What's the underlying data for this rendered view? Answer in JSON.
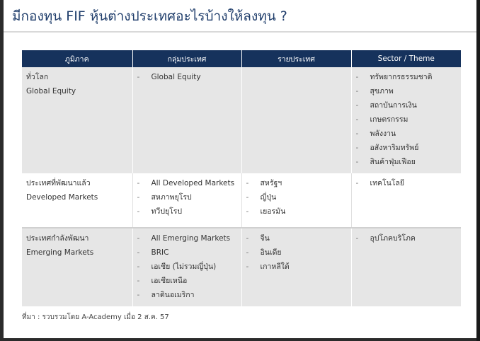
{
  "title": "มีกองทุน FIF หุ้นต่างประเทศอะไรบ้างให้ลงทุน ?",
  "table": {
    "headers": [
      "ภูมิภาค",
      "กลุ่มประเทศ",
      "รายประเทศ",
      "Sector / Theme"
    ],
    "rows": [
      {
        "region": [
          "ทั่วโลก",
          "Global Equity"
        ],
        "groups": [
          "Global Equity"
        ],
        "countries": [],
        "sectors": [
          "ทรัพยากรธรรมชาติ",
          "สุขภาพ",
          "สถาบันการเงิน",
          "เกษตรกรรม",
          "พลังงาน",
          "อสังหาริมทรัพย์",
          "สินค้าฟุ่มเฟือย"
        ]
      },
      {
        "region": [
          "ประเทศที่พัฒนาแล้ว",
          "Developed Markets"
        ],
        "groups": [
          "All Developed Markets",
          "สหภาพยุโรป",
          "ทวีปยุโรป"
        ],
        "countries": [
          "สหรัฐฯ",
          "ญี่ปุ่น",
          "เยอรมัน"
        ],
        "sectors": [
          "เทคโนโลยี"
        ]
      },
      {
        "region": [
          "ประเทศกำลังพัฒนา",
          "Emerging Markets"
        ],
        "groups": [
          "All Emerging Markets",
          "BRIC",
          "เอเชีย (ไม่รวมญี่ปุ่น)",
          "เอเชียเหนือ",
          "ลาตินอเมริกา"
        ],
        "countries": [
          "จีน",
          "อินเดีย",
          "เกาหลีใต้"
        ],
        "sectors": [
          "อุปโภคบริโภค"
        ]
      }
    ]
  },
  "bullet": "-",
  "source": "ที่มา : รวบรวมโดย A-Academy เมื่อ 2 ส.ค. 57"
}
